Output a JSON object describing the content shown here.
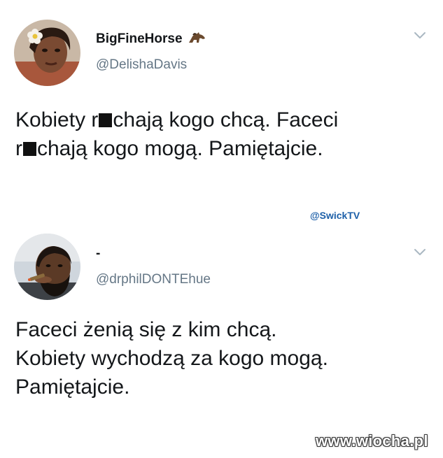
{
  "tweets": [
    {
      "display_name": "BigFineHorse",
      "name_emoji": "horse-icon",
      "handle": "@DelishaDavis",
      "menu_icon": "chevron-down-icon",
      "text_lines": [
        {
          "before": "Kobiety r",
          "after": "chają kogo chcą. Faceci"
        },
        {
          "before": "r",
          "after": "chają kogo mogą. Pamiętajcie."
        }
      ]
    },
    {
      "display_name": "-",
      "handle": "@drphilDONTEhue",
      "menu_icon": "chevron-down-icon",
      "text_lines": [
        "Faceci żenią się z kim chcą.",
        "Kobiety wychodzą za kogo mogą.",
        "Pamiętajcie."
      ]
    }
  ],
  "source_tag": "@SwickTV",
  "watermark": "www.wiocha.pl",
  "colors": {
    "text": "#14171a",
    "handle": "#657786",
    "source_tag": "#1c5fa8",
    "caret": "#aab8c2"
  }
}
